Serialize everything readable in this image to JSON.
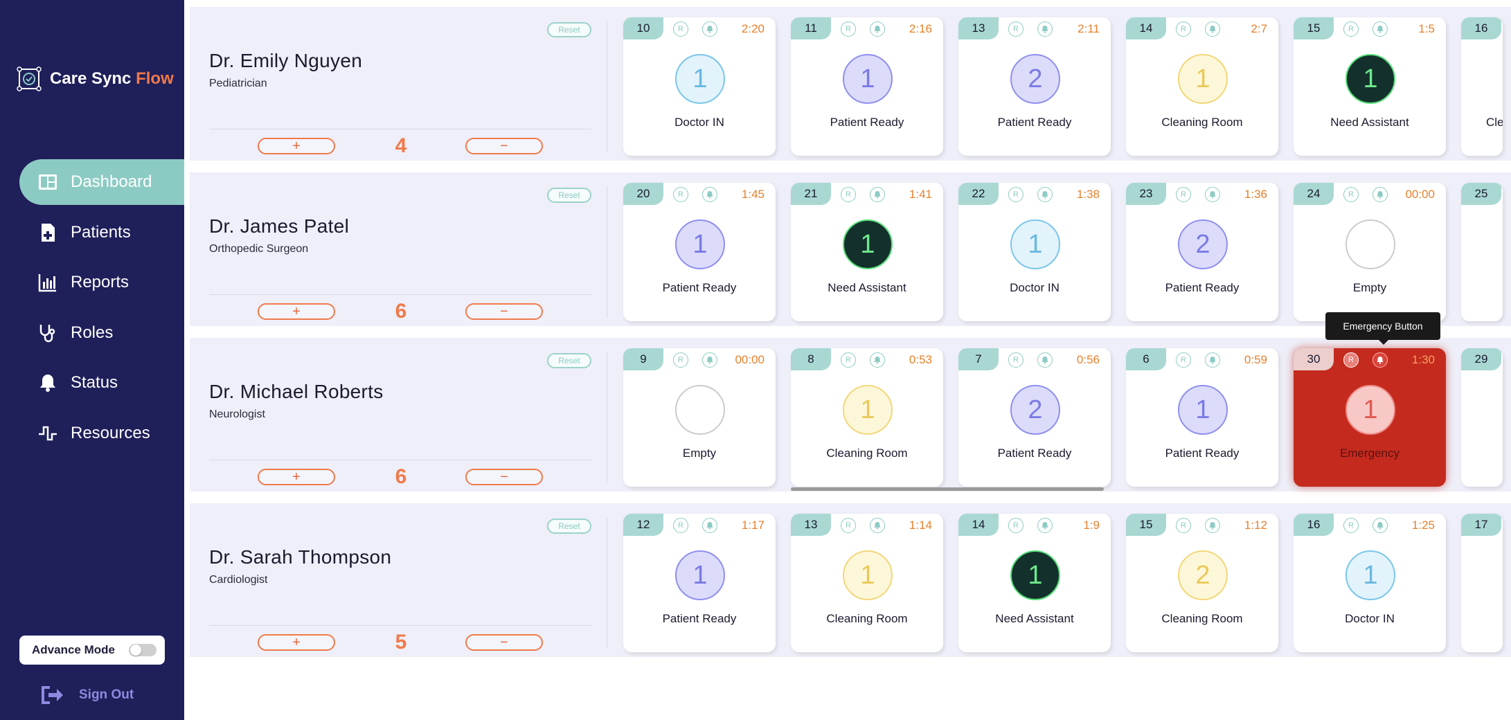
{
  "brand": {
    "name_part1": "Care Sync",
    "name_part2": "Flow"
  },
  "nav": [
    {
      "label": "Dashboard",
      "icon": "dashboard-icon",
      "active": true
    },
    {
      "label": "Patients",
      "icon": "patient-file-icon"
    },
    {
      "label": "Reports",
      "icon": "bar-chart-icon"
    },
    {
      "label": "Roles",
      "icon": "stethoscope-icon"
    },
    {
      "label": "Status",
      "icon": "bell-icon"
    },
    {
      "label": "Resources",
      "icon": "pulse-icon"
    }
  ],
  "advance_mode": {
    "label": "Advance Mode",
    "enabled": false
  },
  "signout": {
    "label": "Sign Out"
  },
  "common": {
    "reset": "Reset",
    "plus": "+",
    "minus": "−",
    "r": "R"
  },
  "colors": {
    "sidebar": "#1f1f5a",
    "active": "#8ccbc3",
    "accent": "#f07a4b",
    "doctor_in": "#7bc6ea",
    "patient_ready": "#8f8ff0",
    "cleaning": "#f2d77a",
    "need_assistant": "#14302c",
    "emergency": "#c42b1e"
  },
  "rows": [
    {
      "doctor": "Dr. Emily Nguyen",
      "specialty": "Pediatrician",
      "count": "4",
      "rooms": [
        {
          "num": "10",
          "timer": "2:20",
          "value": "1",
          "status": "Doctor IN",
          "type": "doctor"
        },
        {
          "num": "11",
          "timer": "2:16",
          "value": "1",
          "status": "Patient Ready",
          "type": "patient"
        },
        {
          "num": "13",
          "timer": "2:11",
          "value": "2",
          "status": "Patient Ready",
          "type": "patient"
        },
        {
          "num": "14",
          "timer": "2:7",
          "value": "1",
          "status": "Cleaning Room",
          "type": "cleaning"
        },
        {
          "num": "15",
          "timer": "1:5",
          "value": "1",
          "status": "Need Assistant",
          "type": "assist"
        },
        {
          "num": "16",
          "timer": "",
          "value": "",
          "status": "Cle",
          "type": "cut"
        }
      ]
    },
    {
      "doctor": "Dr. James Patel",
      "specialty": "Orthopedic Surgeon",
      "count": "6",
      "rooms": [
        {
          "num": "20",
          "timer": "1:45",
          "value": "1",
          "status": "Patient Ready",
          "type": "patient"
        },
        {
          "num": "21",
          "timer": "1:41",
          "value": "1",
          "status": "Need Assistant",
          "type": "assist"
        },
        {
          "num": "22",
          "timer": "1:38",
          "value": "1",
          "status": "Doctor IN",
          "type": "doctor"
        },
        {
          "num": "23",
          "timer": "1:36",
          "value": "2",
          "status": "Patient Ready",
          "type": "patient"
        },
        {
          "num": "24",
          "timer": "00:00",
          "value": "",
          "status": "Empty",
          "type": "empty"
        },
        {
          "num": "25",
          "timer": "",
          "value": "",
          "status": "",
          "type": "cut"
        }
      ]
    },
    {
      "doctor": "Dr. Michael Roberts",
      "specialty": "Neurologist",
      "count": "6",
      "rooms": [
        {
          "num": "9",
          "timer": "00:00",
          "value": "",
          "status": "Empty",
          "type": "empty"
        },
        {
          "num": "8",
          "timer": "0:53",
          "value": "1",
          "status": "Cleaning Room",
          "type": "cleaning"
        },
        {
          "num": "7",
          "timer": "0:56",
          "value": "2",
          "status": "Patient Ready",
          "type": "patient"
        },
        {
          "num": "6",
          "timer": "0:59",
          "value": "1",
          "status": "Patient Ready",
          "type": "patient"
        },
        {
          "num": "30",
          "timer": "1:30",
          "value": "1",
          "status": "Emergency",
          "type": "emergency"
        },
        {
          "num": "29",
          "timer": "",
          "value": "",
          "status": "",
          "type": "cut"
        }
      ]
    },
    {
      "doctor": "Dr. Sarah Thompson",
      "specialty": "Cardiologist",
      "count": "5",
      "rooms": [
        {
          "num": "12",
          "timer": "1:17",
          "value": "1",
          "status": "Patient Ready",
          "type": "patient"
        },
        {
          "num": "13",
          "timer": "1:14",
          "value": "1",
          "status": "Cleaning Room",
          "type": "cleaning"
        },
        {
          "num": "14",
          "timer": "1:9",
          "value": "1",
          "status": "Need Assistant",
          "type": "assist"
        },
        {
          "num": "15",
          "timer": "1:12",
          "value": "2",
          "status": "Cleaning Room",
          "type": "cleaning"
        },
        {
          "num": "16",
          "timer": "1:25",
          "value": "1",
          "status": "Doctor IN",
          "type": "doctor"
        },
        {
          "num": "17",
          "timer": "",
          "value": "",
          "status": "",
          "type": "cut"
        }
      ]
    }
  ],
  "tooltip": {
    "text": "Emergency Button"
  }
}
